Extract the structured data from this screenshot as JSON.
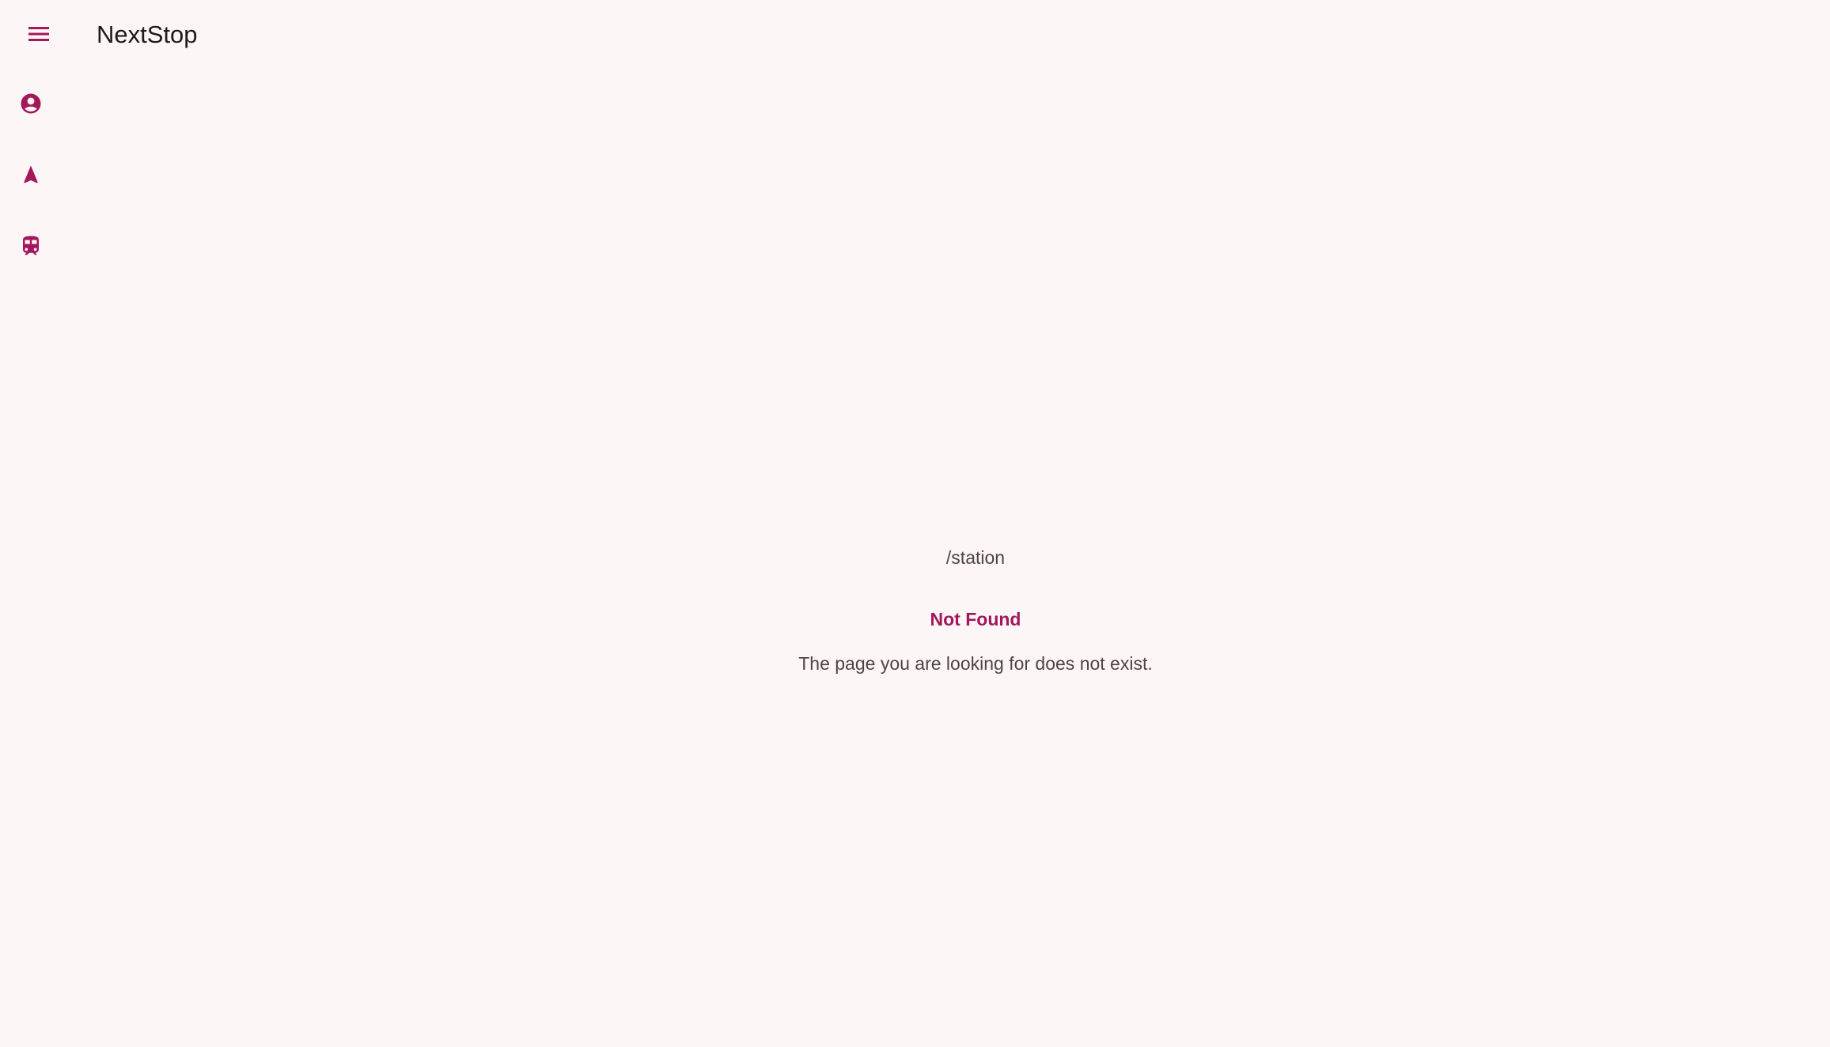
{
  "app": {
    "title": "NextStop",
    "accent_color": "#a3175c",
    "background_color": "#fdf6f7"
  },
  "header": {
    "menu_icon": "menu-icon"
  },
  "rail": {
    "items": [
      {
        "icon": "account-circle-icon"
      },
      {
        "icon": "navigation-arrow-icon"
      },
      {
        "icon": "train-icon"
      }
    ]
  },
  "main": {
    "path": "/station",
    "error_title": "Not Found",
    "error_message": "The page you are looking for does not exist."
  }
}
